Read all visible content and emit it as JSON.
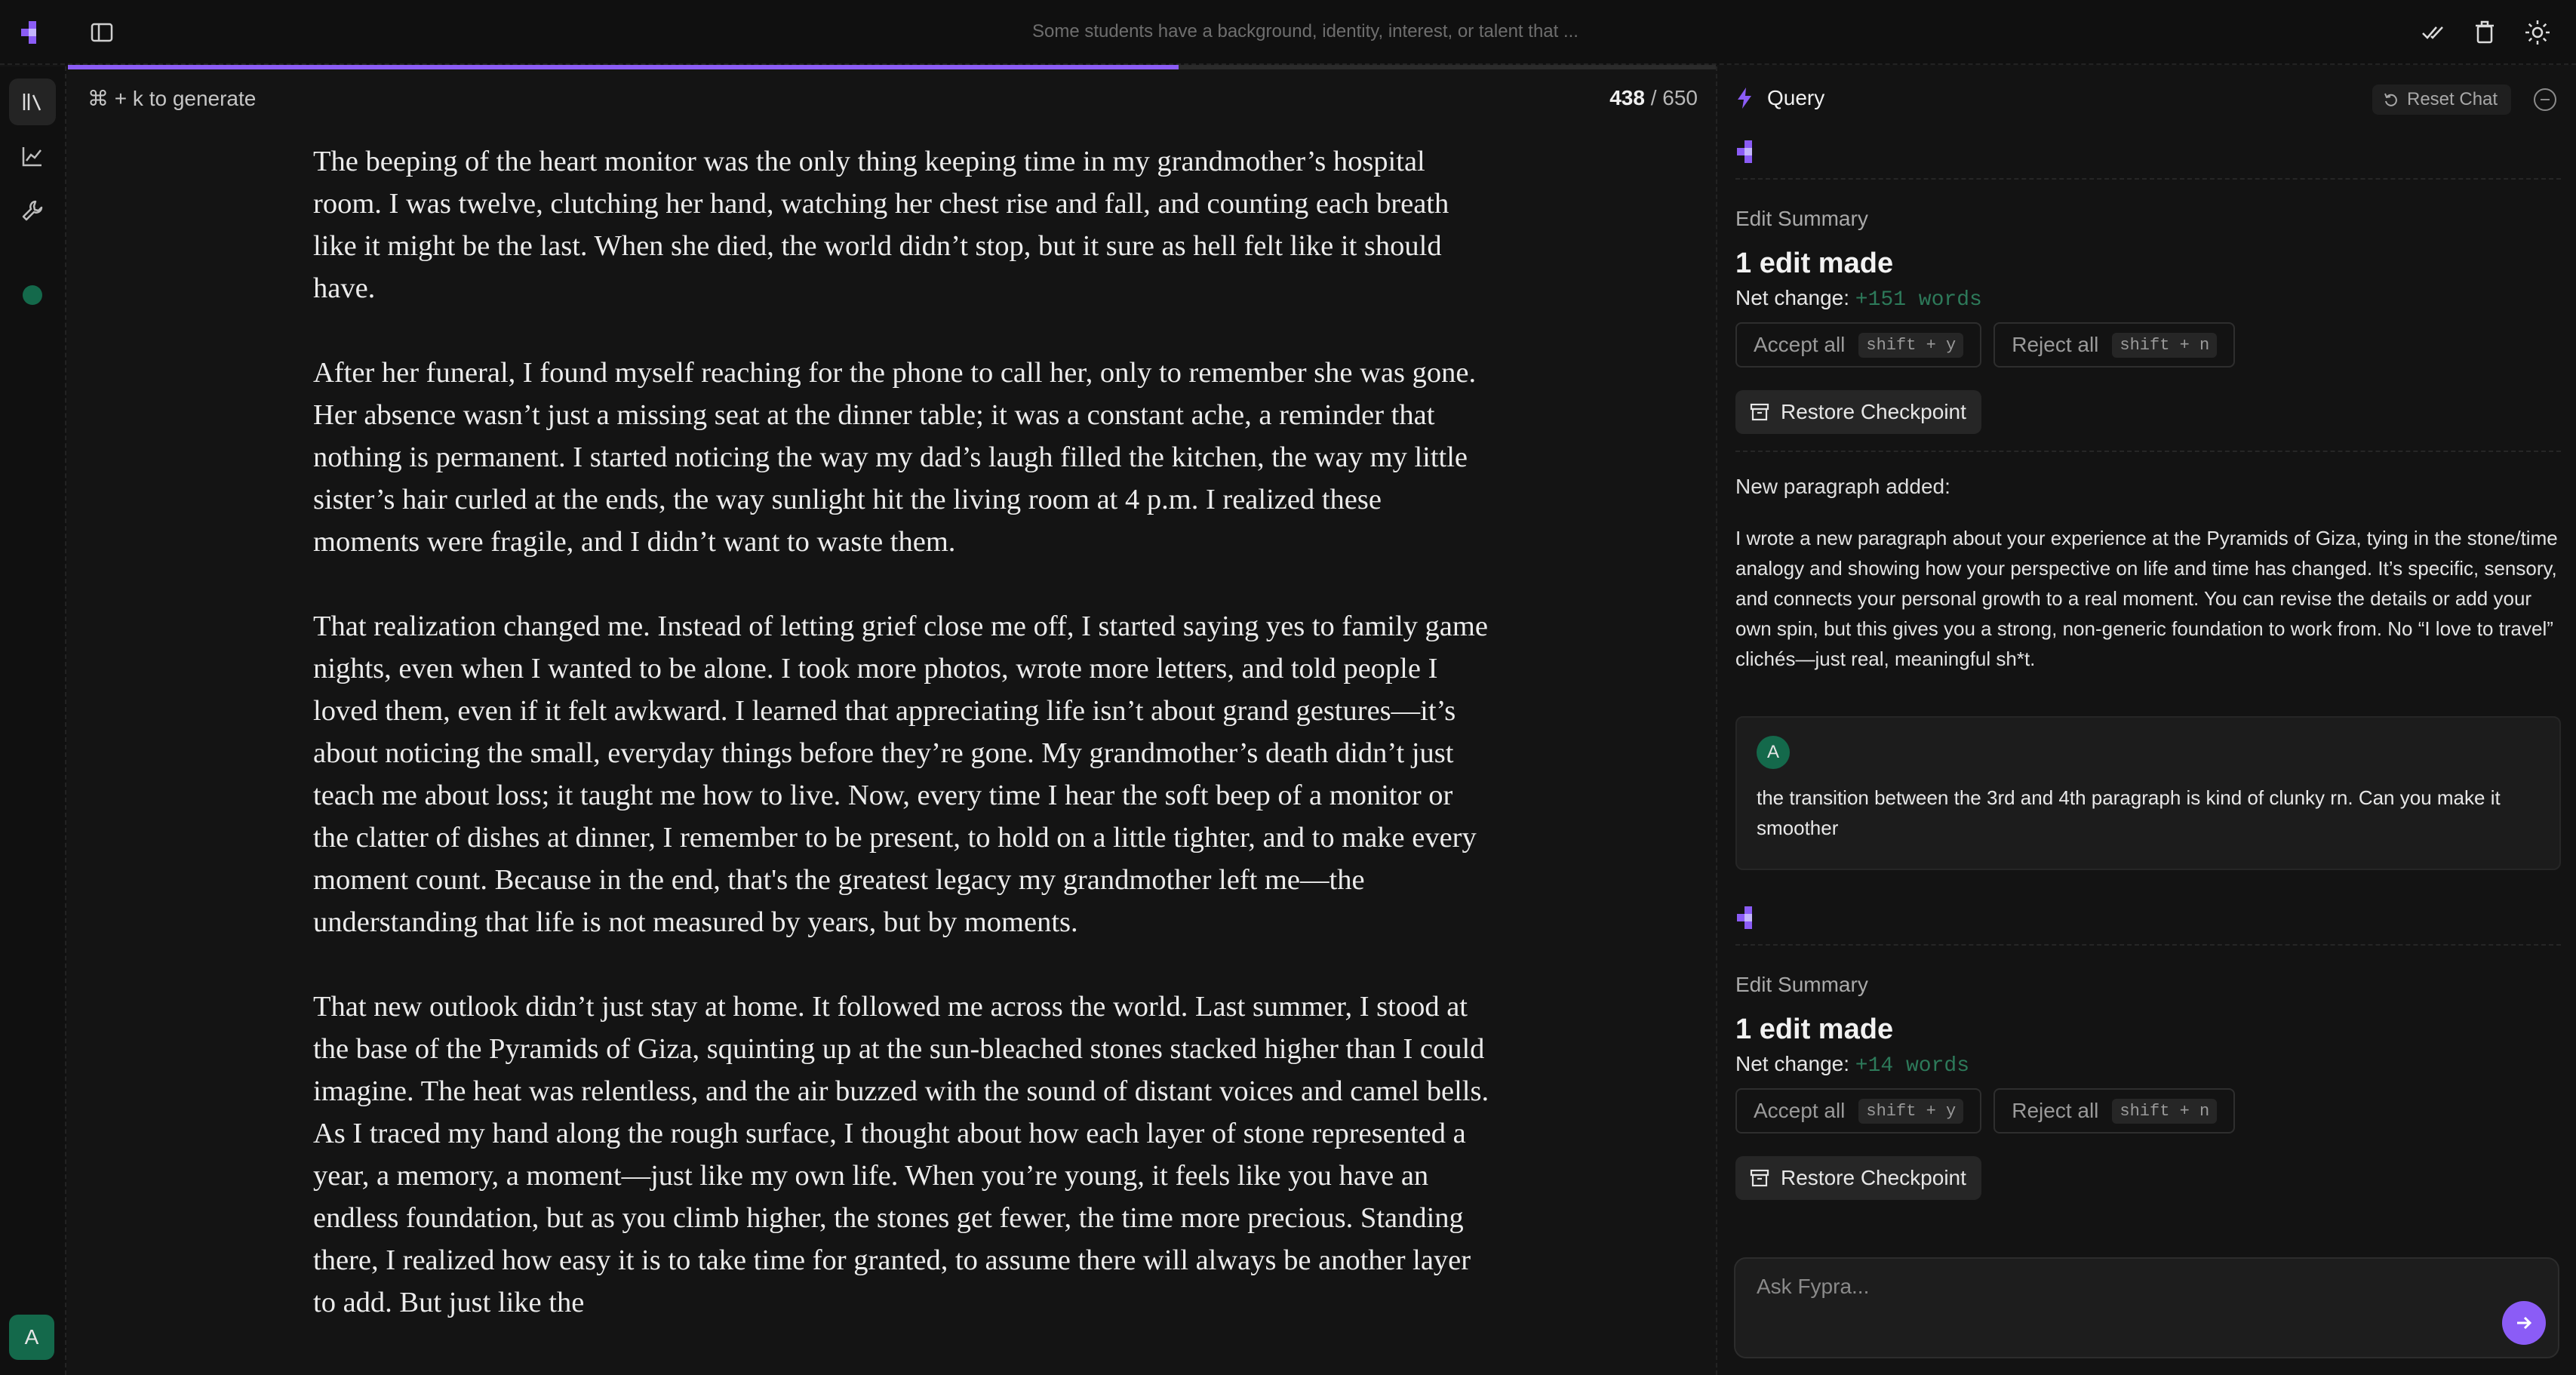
{
  "app": {
    "document_title": "Some students have a background, identity, interest, or talent that ...",
    "brand_color": "#8b5cf6",
    "accent_green": "#14694b"
  },
  "editor": {
    "generate_hint": "⌘ + k to generate",
    "word_count": {
      "current": "438",
      "separator": "/",
      "max": "650"
    },
    "progress_fraction": 0.674,
    "paragraphs": [
      "The beeping of the heart monitor was the only thing keeping time in my grandmother’s hospital room. I was twelve, clutching her hand, watching her chest rise and fall, and counting each breath like it might be the last. When she died, the world didn’t stop, but it sure as hell felt like it should have.",
      "After her funeral, I found myself reaching for the phone to call her, only to remember she was gone. Her absence wasn’t just a missing seat at the dinner table; it was a constant ache, a reminder that nothing is permanent. I started noticing the way my dad’s laugh filled the kitchen, the way my little sister’s hair curled at the ends, the way sunlight hit the living room at 4 p.m. I realized these moments were fragile, and I didn’t want to waste them.",
      "That realization changed me. Instead of letting grief close me off, I started saying yes to family game nights, even when I wanted to be alone. I took more photos, wrote more letters, and told people I loved them, even if it felt awkward. I learned that appreciating life isn’t about grand gestures—it’s about noticing the small, everyday things before they’re gone. My grandmother’s death didn’t just teach me about loss; it taught me how to live. Now, every time I hear the soft beep of a monitor or the clatter of dishes at dinner, I remember to be present, to hold on a little tighter, and to make every moment count. Because in the end, that's the greatest legacy my grandmother left me—the understanding that life is not measured by years, but by moments.",
      "That new outlook didn’t just stay at home. It followed me across the world. Last summer, I stood at the base of the Pyramids of Giza, squinting up at the sun-bleached stones stacked higher than I could imagine. The heat was relentless, and the air buzzed with the sound of distant voices and camel bells. As I traced my hand along the rough surface, I thought about how each layer of stone represented a year, a memory, a moment—just like my own life. When you’re young, it feels like you have an endless foundation, but as you climb higher, the stones get fewer, the time more precious. Standing there, I realized how easy it is to take time for granted, to assume there will always be another layer to add. But just like the"
    ]
  },
  "panel": {
    "title": "Query",
    "reset_label": "Reset Chat",
    "messages": [
      {
        "edit_summary_label": "Edit Summary",
        "edit_count": "1 edit made",
        "net_change_label": "Net change:",
        "net_change_value": "+151 words",
        "accept_label": "Accept all",
        "accept_shortcut": "shift + y",
        "reject_label": "Reject all",
        "reject_shortcut": "shift + n",
        "restore_label": "Restore Checkpoint",
        "new_paragraph_label": "New paragraph added:",
        "reply": "I wrote a new paragraph about your experience at the Pyramids of Giza, tying in the stone/time analogy and showing how your perspective on life and time has changed. It’s specific, sensory, and connects your personal growth to a real moment. You can revise the details or add your own spin, but this gives you a strong, non-generic foundation to work from. No “I love to travel” clichés—just real, meaningful sh*t."
      },
      {
        "edit_summary_label": "Edit Summary",
        "edit_count": "1 edit made",
        "net_change_label": "Net change:",
        "net_change_value": "+14 words",
        "accept_label": "Accept all",
        "accept_shortcut": "shift + y",
        "reject_label": "Reject all",
        "reject_shortcut": "shift + n",
        "restore_label": "Restore Checkpoint"
      }
    ],
    "user_message": {
      "avatar_letter": "A",
      "text": "the transition between the 3rd and 4th paragraph is kind of clunky rn. Can you make it smoother"
    },
    "composer_placeholder": "Ask Fypra..."
  },
  "user": {
    "avatar_letter": "A"
  }
}
